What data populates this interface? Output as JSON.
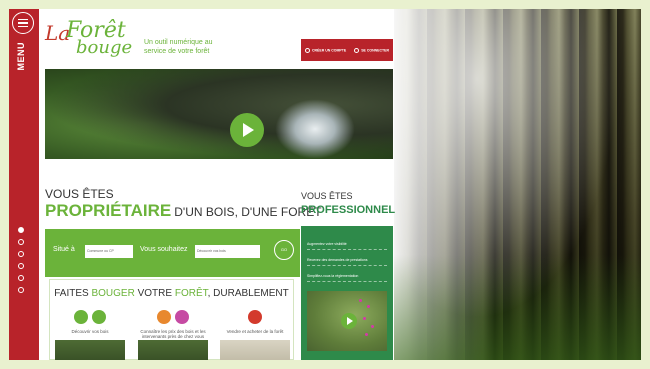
{
  "sidebar": {
    "menu_label": "MENU",
    "dots": [
      true,
      false,
      false,
      false,
      false,
      false
    ]
  },
  "logo": {
    "la": "La",
    "foret": "Forêt",
    "bouge": "bouge"
  },
  "tagline": "Un outil numérique au service de votre forêt",
  "header": {
    "create_account": "CRÉER UN COMPTE",
    "login": "SE CONNECTER"
  },
  "owner": {
    "vous_etes": "VOUS ÊTES",
    "title": "PROPRIÉTAIRE",
    "subtitle": "D'UN BOIS, D'UNE FORÊT",
    "situe_label": "Situé à",
    "commune_placeholder": "Commune ou CP",
    "souhaitez_label": "Vous souhaitez",
    "choice_placeholder": "Découvrir vos bois",
    "go": "GO"
  },
  "faites": {
    "p1": "FAITES ",
    "p2": "BOUGER",
    "p3": " VOTRE ",
    "p4": "FORÊT",
    "p5": ", DURABLEMENT",
    "col1": "Découvrir vos bois",
    "col2": "Connaître les prix des bois et les intervenants près de chez vous",
    "col3": "Vendre et acheter de la forêt"
  },
  "pro": {
    "vous_etes": "VOUS ÊTES",
    "title": "PROFESSIONNEL",
    "items": [
      "Augmentez votre visibilité",
      "Recevez des demandes de prestations",
      "Simplifiez-vous la réglementation"
    ]
  }
}
